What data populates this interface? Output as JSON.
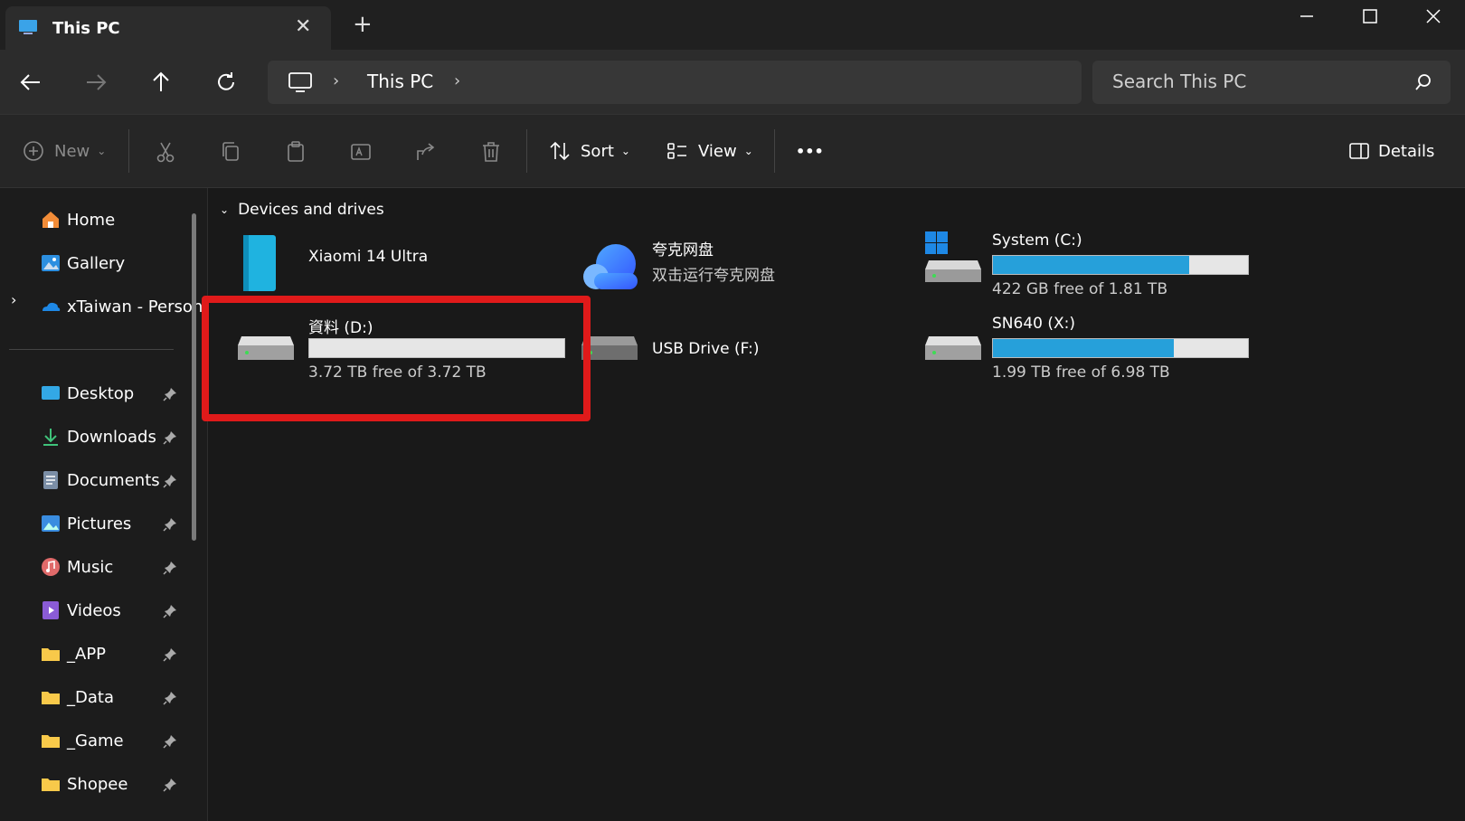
{
  "window": {
    "tab_title": "This PC",
    "new_tab": "+"
  },
  "nav": {
    "address_segment": "This PC",
    "chevron": "›",
    "search_placeholder": "Search This PC"
  },
  "toolbar": {
    "new_label": "New",
    "sort_label": "Sort",
    "view_label": "View",
    "more_label": "•••",
    "details_label": "Details"
  },
  "sidebar": {
    "items": [
      {
        "label": "Home",
        "icon": "home-icon"
      },
      {
        "label": "Gallery",
        "icon": "gallery-icon"
      },
      {
        "label": "xTaiwan - Person",
        "icon": "onedrive-icon"
      }
    ],
    "pinned": [
      {
        "label": "Desktop",
        "icon": "desktop-icon"
      },
      {
        "label": "Downloads",
        "icon": "downloads-icon"
      },
      {
        "label": "Documents",
        "icon": "documents-icon"
      },
      {
        "label": "Pictures",
        "icon": "pictures-icon"
      },
      {
        "label": "Music",
        "icon": "music-icon"
      },
      {
        "label": "Videos",
        "icon": "videos-icon"
      },
      {
        "label": "_APP",
        "icon": "folder-icon"
      },
      {
        "label": "_Data",
        "icon": "folder-icon"
      },
      {
        "label": "_Game",
        "icon": "folder-icon"
      },
      {
        "label": "Shopee",
        "icon": "folder-icon"
      }
    ]
  },
  "content": {
    "group_label": "Devices and drives",
    "devices": [
      {
        "name": "Xiaomi 14 Ultra",
        "icon": "phone-icon"
      },
      {
        "name": "夸克网盘",
        "sub": "双击运行夸克网盘",
        "icon": "cloud-drive-icon"
      },
      {
        "name": "System (C:)",
        "sub": "422 GB free of 1.81 TB",
        "used_fraction": 0.77,
        "icon": "windows-drive-icon"
      },
      {
        "name": "資料 (D:)",
        "sub": "3.72 TB free of 3.72 TB",
        "used_fraction": 0.0,
        "icon": "hard-drive-icon"
      },
      {
        "name": "USB Drive (F:)",
        "icon": "usb-drive-icon"
      },
      {
        "name": "SN640 (X:)",
        "sub": "1.99 TB free of 6.98 TB",
        "used_fraction": 0.71,
        "icon": "hard-drive-icon"
      }
    ]
  },
  "colors": {
    "accent": "#26a0da",
    "highlight": "#e01a1a",
    "folder": "#f8c94a"
  }
}
